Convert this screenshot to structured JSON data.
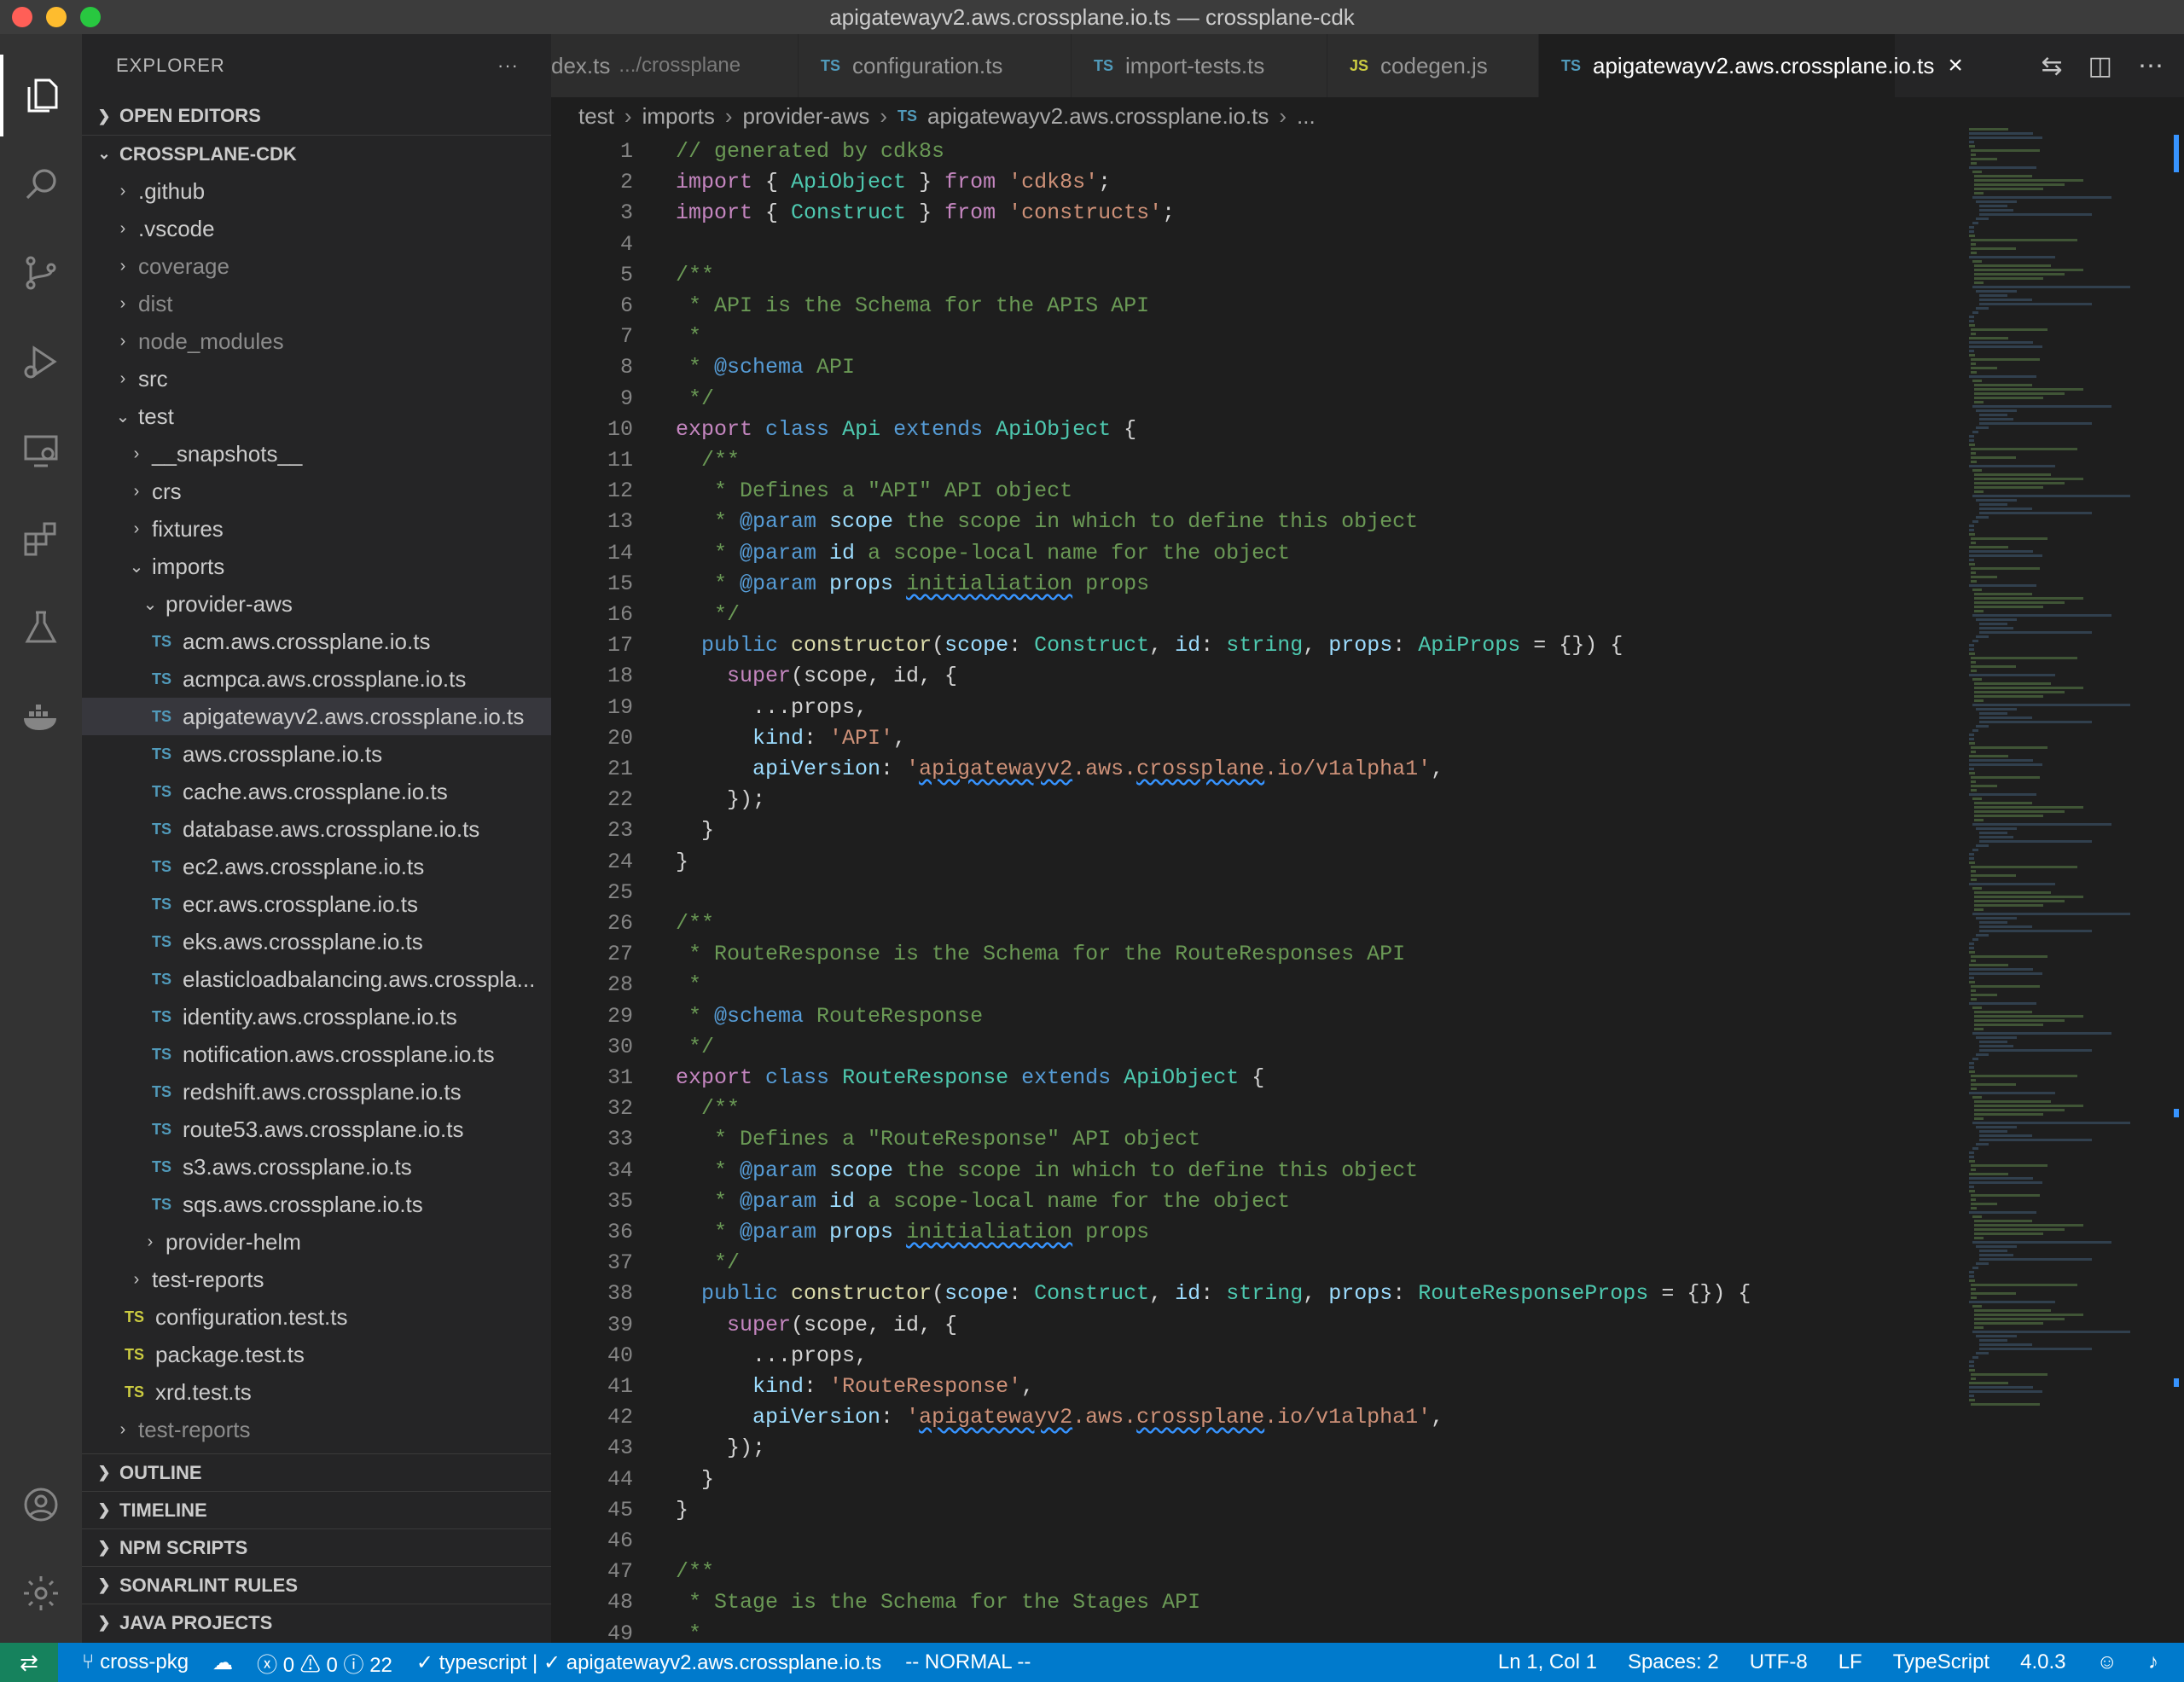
{
  "window": {
    "title": "apigatewayv2.aws.crossplane.io.ts — crossplane-cdk"
  },
  "activity_bar": {
    "icons": [
      "files-icon",
      "search-icon",
      "source-control-icon",
      "run-debug-icon",
      "remote-explorer-icon",
      "extensions-icon",
      "testing-icon",
      "docker-icon",
      "account-icon",
      "settings-gear-icon"
    ]
  },
  "sidebar": {
    "header": "EXPLORER",
    "more": "···",
    "open_editors": "OPEN EDITORS",
    "project": "CROSSPLANE-CDK",
    "tree": [
      {
        "label": ".github",
        "indent": 0,
        "kind": "folder",
        "open": false
      },
      {
        "label": ".vscode",
        "indent": 0,
        "kind": "folder",
        "open": false
      },
      {
        "label": "coverage",
        "indent": 0,
        "kind": "folder",
        "open": false,
        "dim": true
      },
      {
        "label": "dist",
        "indent": 0,
        "kind": "folder",
        "open": false,
        "dim": true
      },
      {
        "label": "node_modules",
        "indent": 0,
        "kind": "folder",
        "open": false,
        "dim": true
      },
      {
        "label": "src",
        "indent": 0,
        "kind": "folder",
        "open": false
      },
      {
        "label": "test",
        "indent": 0,
        "kind": "folder",
        "open": true
      },
      {
        "label": "__snapshots__",
        "indent": 1,
        "kind": "folder",
        "open": false
      },
      {
        "label": "crs",
        "indent": 1,
        "kind": "folder",
        "open": false
      },
      {
        "label": "fixtures",
        "indent": 1,
        "kind": "folder",
        "open": false
      },
      {
        "label": "imports",
        "indent": 1,
        "kind": "folder",
        "open": true
      },
      {
        "label": "provider-aws",
        "indent": 2,
        "kind": "folder",
        "open": true
      },
      {
        "label": "acm.aws.crossplane.io.ts",
        "indent": 3,
        "kind": "ts"
      },
      {
        "label": "acmpca.aws.crossplane.io.ts",
        "indent": 3,
        "kind": "ts"
      },
      {
        "label": "apigatewayv2.aws.crossplane.io.ts",
        "indent": 3,
        "kind": "ts",
        "selected": true
      },
      {
        "label": "aws.crossplane.io.ts",
        "indent": 3,
        "kind": "ts"
      },
      {
        "label": "cache.aws.crossplane.io.ts",
        "indent": 3,
        "kind": "ts"
      },
      {
        "label": "database.aws.crossplane.io.ts",
        "indent": 3,
        "kind": "ts"
      },
      {
        "label": "ec2.aws.crossplane.io.ts",
        "indent": 3,
        "kind": "ts"
      },
      {
        "label": "ecr.aws.crossplane.io.ts",
        "indent": 3,
        "kind": "ts"
      },
      {
        "label": "eks.aws.crossplane.io.ts",
        "indent": 3,
        "kind": "ts"
      },
      {
        "label": "elasticloadbalancing.aws.crosspla...",
        "indent": 3,
        "kind": "ts"
      },
      {
        "label": "identity.aws.crossplane.io.ts",
        "indent": 3,
        "kind": "ts"
      },
      {
        "label": "notification.aws.crossplane.io.ts",
        "indent": 3,
        "kind": "ts"
      },
      {
        "label": "redshift.aws.crossplane.io.ts",
        "indent": 3,
        "kind": "ts"
      },
      {
        "label": "route53.aws.crossplane.io.ts",
        "indent": 3,
        "kind": "ts"
      },
      {
        "label": "s3.aws.crossplane.io.ts",
        "indent": 3,
        "kind": "ts"
      },
      {
        "label": "sqs.aws.crossplane.io.ts",
        "indent": 3,
        "kind": "ts"
      },
      {
        "label": "provider-helm",
        "indent": 2,
        "kind": "folder",
        "open": false
      },
      {
        "label": "test-reports",
        "indent": 1,
        "kind": "folder",
        "open": false
      },
      {
        "label": "configuration.test.ts",
        "indent": 1,
        "kind": "test"
      },
      {
        "label": "package.test.ts",
        "indent": 1,
        "kind": "test"
      },
      {
        "label": "xrd.test.ts",
        "indent": 1,
        "kind": "test"
      },
      {
        "label": "test-reports",
        "indent": 0,
        "kind": "folder",
        "open": false,
        "dim": true
      }
    ],
    "bottom_sections": [
      "OUTLINE",
      "TIMELINE",
      "NPM SCRIPTS",
      "SONARLINT RULES",
      "JAVA PROJECTS"
    ]
  },
  "tabs": [
    {
      "label": "dex.ts",
      "desc": ".../crossplane",
      "badge": ""
    },
    {
      "label": "configuration.ts",
      "badge": "TS"
    },
    {
      "label": "import-tests.ts",
      "badge": "TS"
    },
    {
      "label": "codegen.js",
      "badge": "JS"
    },
    {
      "label": "apigatewayv2.aws.crossplane.io.ts",
      "badge": "TS",
      "active": true,
      "close": "×"
    }
  ],
  "breadcrumb": [
    "test",
    "imports",
    "provider-aws",
    "apigatewayv2.aws.crossplane.io.ts",
    "..."
  ],
  "code_lines": [
    "// generated by cdk8s",
    "import { ApiObject } from 'cdk8s';",
    "import { Construct } from 'constructs';",
    "",
    "/**",
    " * API is the Schema for the APIS API",
    " *",
    " * @schema API",
    " */",
    "export class Api extends ApiObject {",
    "  /**",
    "   * Defines a \"API\" API object",
    "   * @param scope the scope in which to define this object",
    "   * @param id a scope-local name for the object",
    "   * @param props initialiation props",
    "   */",
    "  public constructor(scope: Construct, id: string, props: ApiProps = {}) {",
    "    super(scope, id, {",
    "      ...props,",
    "      kind: 'API',",
    "      apiVersion: 'apigatewayv2.aws.crossplane.io/v1alpha1',",
    "    });",
    "  }",
    "}",
    "",
    "/**",
    " * RouteResponse is the Schema for the RouteResponses API",
    " *",
    " * @schema RouteResponse",
    " */",
    "export class RouteResponse extends ApiObject {",
    "  /**",
    "   * Defines a \"RouteResponse\" API object",
    "   * @param scope the scope in which to define this object",
    "   * @param id a scope-local name for the object",
    "   * @param props initialiation props",
    "   */",
    "  public constructor(scope: Construct, id: string, props: RouteResponseProps = {}) {",
    "    super(scope, id, {",
    "      ...props,",
    "      kind: 'RouteResponse',",
    "      apiVersion: 'apigatewayv2.aws.crossplane.io/v1alpha1',",
    "    });",
    "  }",
    "}",
    "",
    "/**",
    " * Stage is the Schema for the Stages API",
    " *"
  ],
  "status": {
    "remote": "⇄",
    "branch": "cross-pkg",
    "sync": "☁",
    "errors": "0",
    "warnings": "0",
    "infos": "22",
    "lang_check": "✓ typescript | ✓ apigatewayv2.aws.crossplane.io.ts",
    "mode": "-- NORMAL --",
    "position": "Ln 1, Col 1",
    "spaces": "Spaces: 2",
    "encoding": "UTF-8",
    "eol": "LF",
    "language": "TypeScript",
    "version": "4.0.3"
  }
}
